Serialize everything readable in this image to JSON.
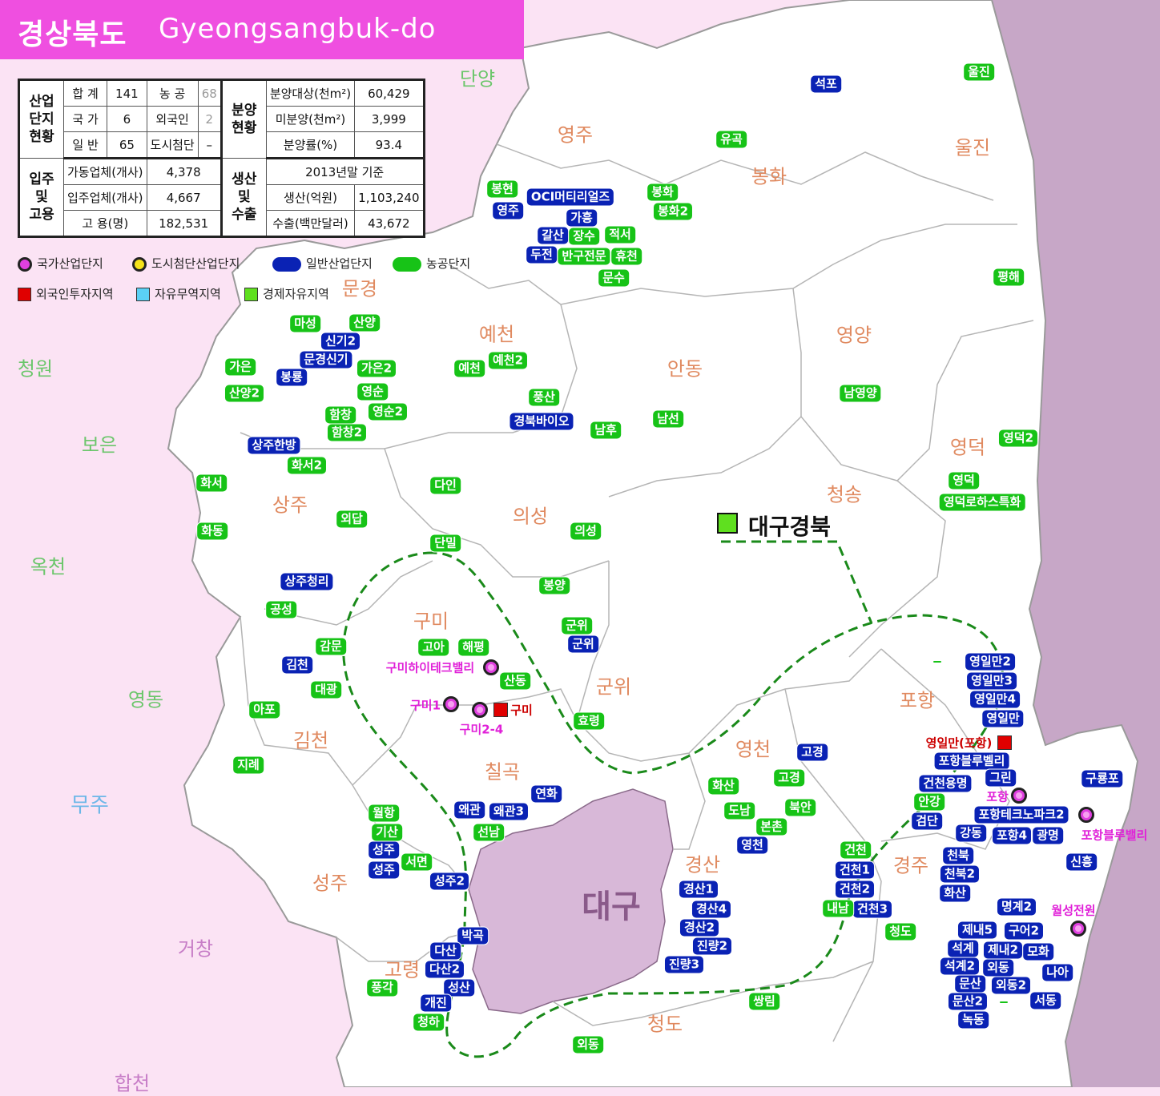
{
  "title": {
    "korean": "경상북도",
    "english": "Gyeongsangbuk-do"
  },
  "stats": {
    "complex_header": "산업\n단지\n현황",
    "complex": [
      {
        "label": "합 계",
        "value": "141",
        "label2": "농 공",
        "value2": "68"
      },
      {
        "label": "국 가",
        "value": "6",
        "label2": "외국인",
        "value2": "2"
      },
      {
        "label": "일 반",
        "value": "65",
        "label2": "도시첨단",
        "value2": "–"
      }
    ],
    "sale_header": "분양\n현황",
    "sale": [
      {
        "label": "분양대상(천m²)",
        "value": "60,429"
      },
      {
        "label": "미분양(천m²)",
        "value": "3,999"
      },
      {
        "label": "분양률(%)",
        "value": "93.4"
      }
    ],
    "tenant_header": "입주\n및\n고용",
    "tenant": [
      {
        "label": "가동업체(개사)",
        "value": "4,378"
      },
      {
        "label": "입주업체(개사)",
        "value": "4,667"
      },
      {
        "label": "고 용(명)",
        "value": "182,531"
      }
    ],
    "prod_header": "생산\n및\n수출",
    "prod_note": "2013년말 기준",
    "prod": [
      {
        "label": "생산(억원)",
        "value": "1,103,240"
      },
      {
        "label": "수출(백만달러)",
        "value": "43,672"
      }
    ]
  },
  "legend": [
    {
      "label": "국가산업단지",
      "icon": "national-complex-icon",
      "color": "#e040e0"
    },
    {
      "label": "도시첨단산업단지",
      "icon": "urban-high-tech-icon",
      "color": "#f5e21a"
    },
    {
      "label": "일반산업단지",
      "icon": "general-complex-icon",
      "color": "#0a22b4"
    },
    {
      "label": "농공단지",
      "icon": "agro-industrial-icon",
      "color": "#17c317"
    },
    {
      "label": "외국인투자지역",
      "icon": "foreign-investment-icon",
      "color": "#e00000"
    },
    {
      "label": "자유무역지역",
      "icon": "free-trade-icon",
      "color": "#5bd0f5"
    },
    {
      "label": "경제자유지역",
      "icon": "free-economic-icon",
      "color": "#5fe01f"
    }
  ],
  "regions": [
    "영주",
    "봉화",
    "울진",
    "문경",
    "예천",
    "안동",
    "영양",
    "영덕",
    "상주",
    "의성",
    "청송",
    "구미",
    "군위",
    "김천",
    "칠곡",
    "영천",
    "포항",
    "성주",
    "경산",
    "경주",
    "고령",
    "청도"
  ],
  "external": [
    "단양",
    "청원",
    "보은",
    "옥천",
    "영동",
    "무주",
    "거창",
    "합천"
  ],
  "daegu": "대구",
  "fez_label": "대구경북",
  "national_sites": [
    "구미하이테크밸리",
    "구미1",
    "구미2-4",
    "포항",
    "포항블루밸리",
    "월성전원"
  ],
  "foreign_sites": [
    "구미",
    "영일만(포항)"
  ],
  "general_tags": [
    "석포",
    "OCI머티리얼즈",
    "영주",
    "가흥",
    "갈산",
    "두전",
    "신기2",
    "문경신기",
    "봉룡",
    "상주한방",
    "경북바이오",
    "상주청리",
    "김천",
    "군위",
    "구미하이테크밸리",
    "구미1",
    "구미2-4",
    "왜관",
    "왜관3",
    "연화",
    "성주",
    "성주2",
    "박곡",
    "다산",
    "다산2",
    "성산",
    "개진",
    "경산1",
    "경산4",
    "경산2",
    "진량2",
    "진량3",
    "고경",
    "영천",
    "건천용명",
    "검단",
    "건천1",
    "건천2",
    "건천3",
    "영일만2",
    "영일만3",
    "영일만4",
    "영일만",
    "포항블루벨리",
    "그린",
    "포항테크노파크2",
    "강동",
    "포항4",
    "광명",
    "구룡포",
    "신흥",
    "천북",
    "천북2",
    "화산",
    "명계2",
    "제내5",
    "구어2",
    "석계",
    "제내2",
    "모화",
    "석계2",
    "외동",
    "나아",
    "문산",
    "외동2",
    "문산2",
    "서동",
    "녹동"
  ],
  "agro_tags": [
    "울진",
    "봉현",
    "봉화",
    "봉화2",
    "유곡",
    "장수",
    "적서",
    "반구전문",
    "휴천",
    "문수",
    "평해",
    "마성",
    "산양",
    "가은",
    "가은2",
    "예천",
    "예천2",
    "산양2",
    "영순",
    "영순2",
    "함창",
    "함창2",
    "풍산",
    "남후",
    "남선",
    "남영양",
    "영덕2",
    "화서2",
    "화서",
    "다인",
    "영덕",
    "영덕로하스특화",
    "외답",
    "의성",
    "화동",
    "단밀",
    "봉양",
    "공성",
    "고아",
    "해평",
    "군위",
    "감문",
    "산동",
    "대광",
    "아포",
    "효령",
    "지례",
    "화산",
    "고경",
    "도남",
    "북안",
    "본촌",
    "안강",
    "월항",
    "기산",
    "선남",
    "서면",
    "건천",
    "내남",
    "청도",
    "쌍림",
    "풍각",
    "청하",
    "외동"
  ]
}
